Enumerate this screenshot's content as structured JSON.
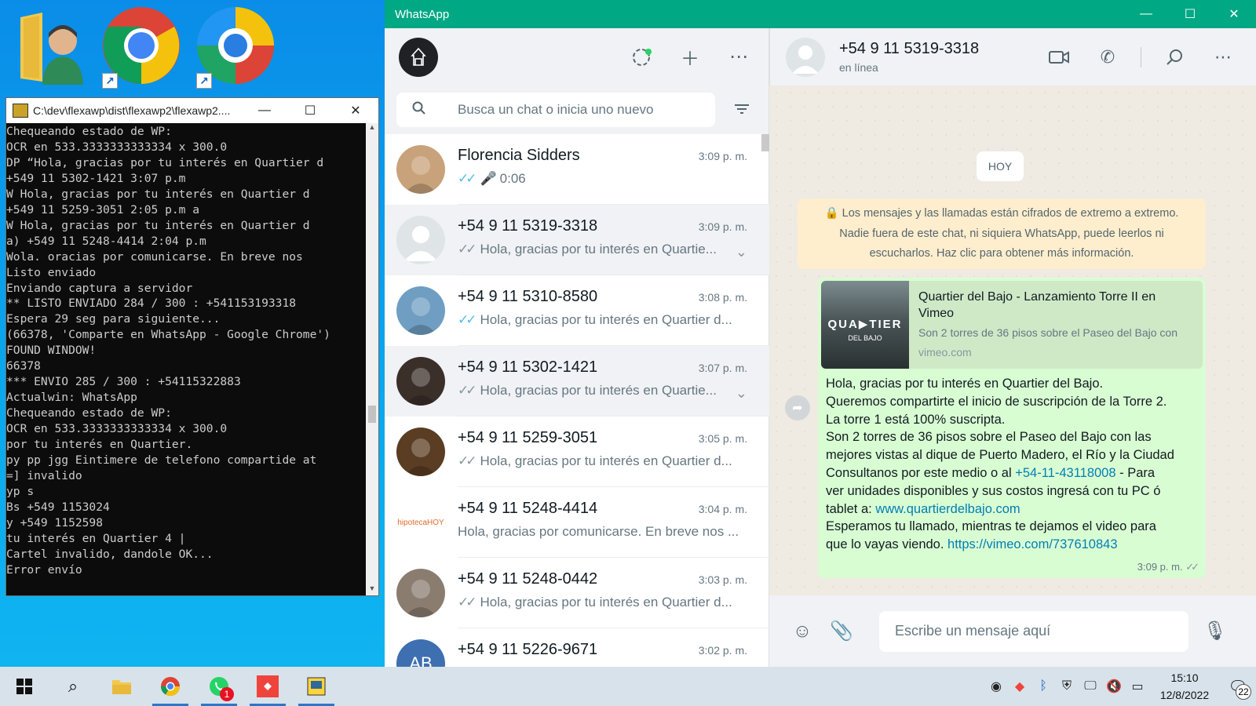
{
  "desktop": {
    "icons": [
      {
        "name": "user-folder-icon"
      },
      {
        "name": "chrome-icon"
      },
      {
        "name": "edge-icon"
      }
    ]
  },
  "console": {
    "title": "C:\\dev\\flexawp\\dist\\flexawp2\\flexawp2....",
    "lines": [
      "Chequeando estado de WP:",
      "OCR en 533.3333333333334 x 300.0",
      "DP “Hola, gracias por tu interés en Quartier d",
      "+549 11 5302-1421 3:07 p.m",
      "W Hola, gracias por tu interés en Quartier d",
      "+549 11 5259-3051 2:05 p.m a",
      "W Hola, gracias por tu interés en Quartier d",
      "a) +549 11 5248-4414 2:04 p.m",
      "Wola. oracias por comunicarse. En breve nos",
      "Listo enviado",
      "Enviando captura a servidor",
      "** LISTO ENVIADO 284 / 300 : +541153193318",
      "Espera 29 seg para siguiente...",
      "(66378, 'Comparte en WhatsApp - Google Chrome')",
      "FOUND WINDOW!",
      "66378",
      "*** ENVIO 285 / 300 : +54115322883",
      "Actualwin: WhatsApp",
      "Chequeando estado de WP:",
      "OCR en 533.3333333333334 x 300.0",
      "por tu interés en Quartier.",
      "py pp jgg Eintimere de telefono compartide at",
      "=] invalido",
      "yp s",
      "Bs +549 1153024",
      "y +549 1152598",
      "tu interés en Quartier 4 |",
      "Cartel invalido, dandole OK...",
      "Error envío"
    ]
  },
  "whatsapp": {
    "window_title": "WhatsApp",
    "search_placeholder": "Busca un chat o inicia uno nuevo",
    "chats": [
      {
        "name": "Florencia Sidders",
        "time": "3:09 p. m.",
        "last": "0:06",
        "ticks": "blue",
        "voice": true,
        "avatar_color": "#c8a27a"
      },
      {
        "name": "+54 9 11 5319-3318",
        "time": "3:09 p. m.",
        "last": "Hola, gracias por tu interés en Quartie...",
        "ticks": "grey",
        "active": true,
        "avatar_color": "#dfe5e7"
      },
      {
        "name": "+54 9 11 5310-8580",
        "time": "3:08 p. m.",
        "last": "Hola, gracias por tu interés en Quartier d...",
        "ticks": "blue",
        "avatar_color": "#6f9ec2"
      },
      {
        "name": "+54 9 11 5302-1421",
        "time": "3:07 p. m.",
        "last": "Hola, gracias por tu interés en Quartie...",
        "ticks": "grey",
        "hover": true,
        "avatar_color": "#3b2f2a"
      },
      {
        "name": "+54 9 11 5259-3051",
        "time": "3:05 p. m.",
        "last": "Hola, gracias por tu interés en Quartier d...",
        "ticks": "grey",
        "avatar_color": "#5a3d22"
      },
      {
        "name": "+54 9 11 5248-4414",
        "time": "3:04 p. m.",
        "last": "Hola, gracias por comunicarse. En breve nos ...",
        "ticks": "none",
        "avatar_color": "#ffffff",
        "avatar_text": "hipotecaHOY"
      },
      {
        "name": "+54 9 11 5248-0442",
        "time": "3:03 p. m.",
        "last": "Hola, gracias por tu interés en Quartier d...",
        "ticks": "grey",
        "avatar_color": "#8a7d70"
      },
      {
        "name": "+54 9 11 5226-9671",
        "time": "3:02 p. m.",
        "last": "",
        "ticks": "none",
        "avatar_color": "#3e6fb0",
        "avatar_text": "AB"
      }
    ],
    "contact": {
      "name": "+54 9 11 5319-3318",
      "status": "en línea"
    },
    "day_label": "HOY",
    "e2e_notice": [
      "Los mensajes y las llamadas están cifrados de extremo a extremo.",
      "Nadie fuera de este chat, ni siquiera WhatsApp, puede leerlos ni",
      "escucharlos. Haz clic para obtener más información."
    ],
    "message": {
      "preview_title": "Quartier del Bajo - Lanzamiento Torre II en Vimeo",
      "preview_desc": "Son 2 torres de 36 pisos sobre el Paseo del Bajo con",
      "preview_domain": "vimeo.com",
      "thumb_text": "QUA▶TIER",
      "thumb_sub": "DEL BAJO",
      "line1": "Hola, gracias por tu interés en Quartier del Bajo.",
      "line2": "Queremos compartirte el inicio de suscripción de la Torre 2.",
      "line3": "La torre 1 está 100% suscripta.",
      "line4": "Son 2 torres de 36 pisos sobre el Paseo del Bajo con las",
      "line5": "mejores vistas al dique de Puerto Madero, el Río y la Ciudad",
      "line6a": "Consultanos por este medio o al ",
      "phone_link": "+54-11-43118008",
      "line6b": " - Para",
      "line7": "ver unidades disponibles y sus costos ingresá con tu PC ó",
      "line8a": "tablet a: ",
      "site_link": "www.quartierdelbajo.com",
      "line9": "Esperamos tu llamado, mientras te dejamos el video para",
      "line10a": "que lo vayas viendo. ",
      "video_link": "https://vimeo.com/737610843",
      "time": "3:09 p. m."
    },
    "composer_placeholder": "Escribe un mensaje aquí"
  },
  "taskbar": {
    "whatsapp_badge": "1",
    "time": "15:10",
    "date": "12/8/2022",
    "notifications": "22"
  }
}
